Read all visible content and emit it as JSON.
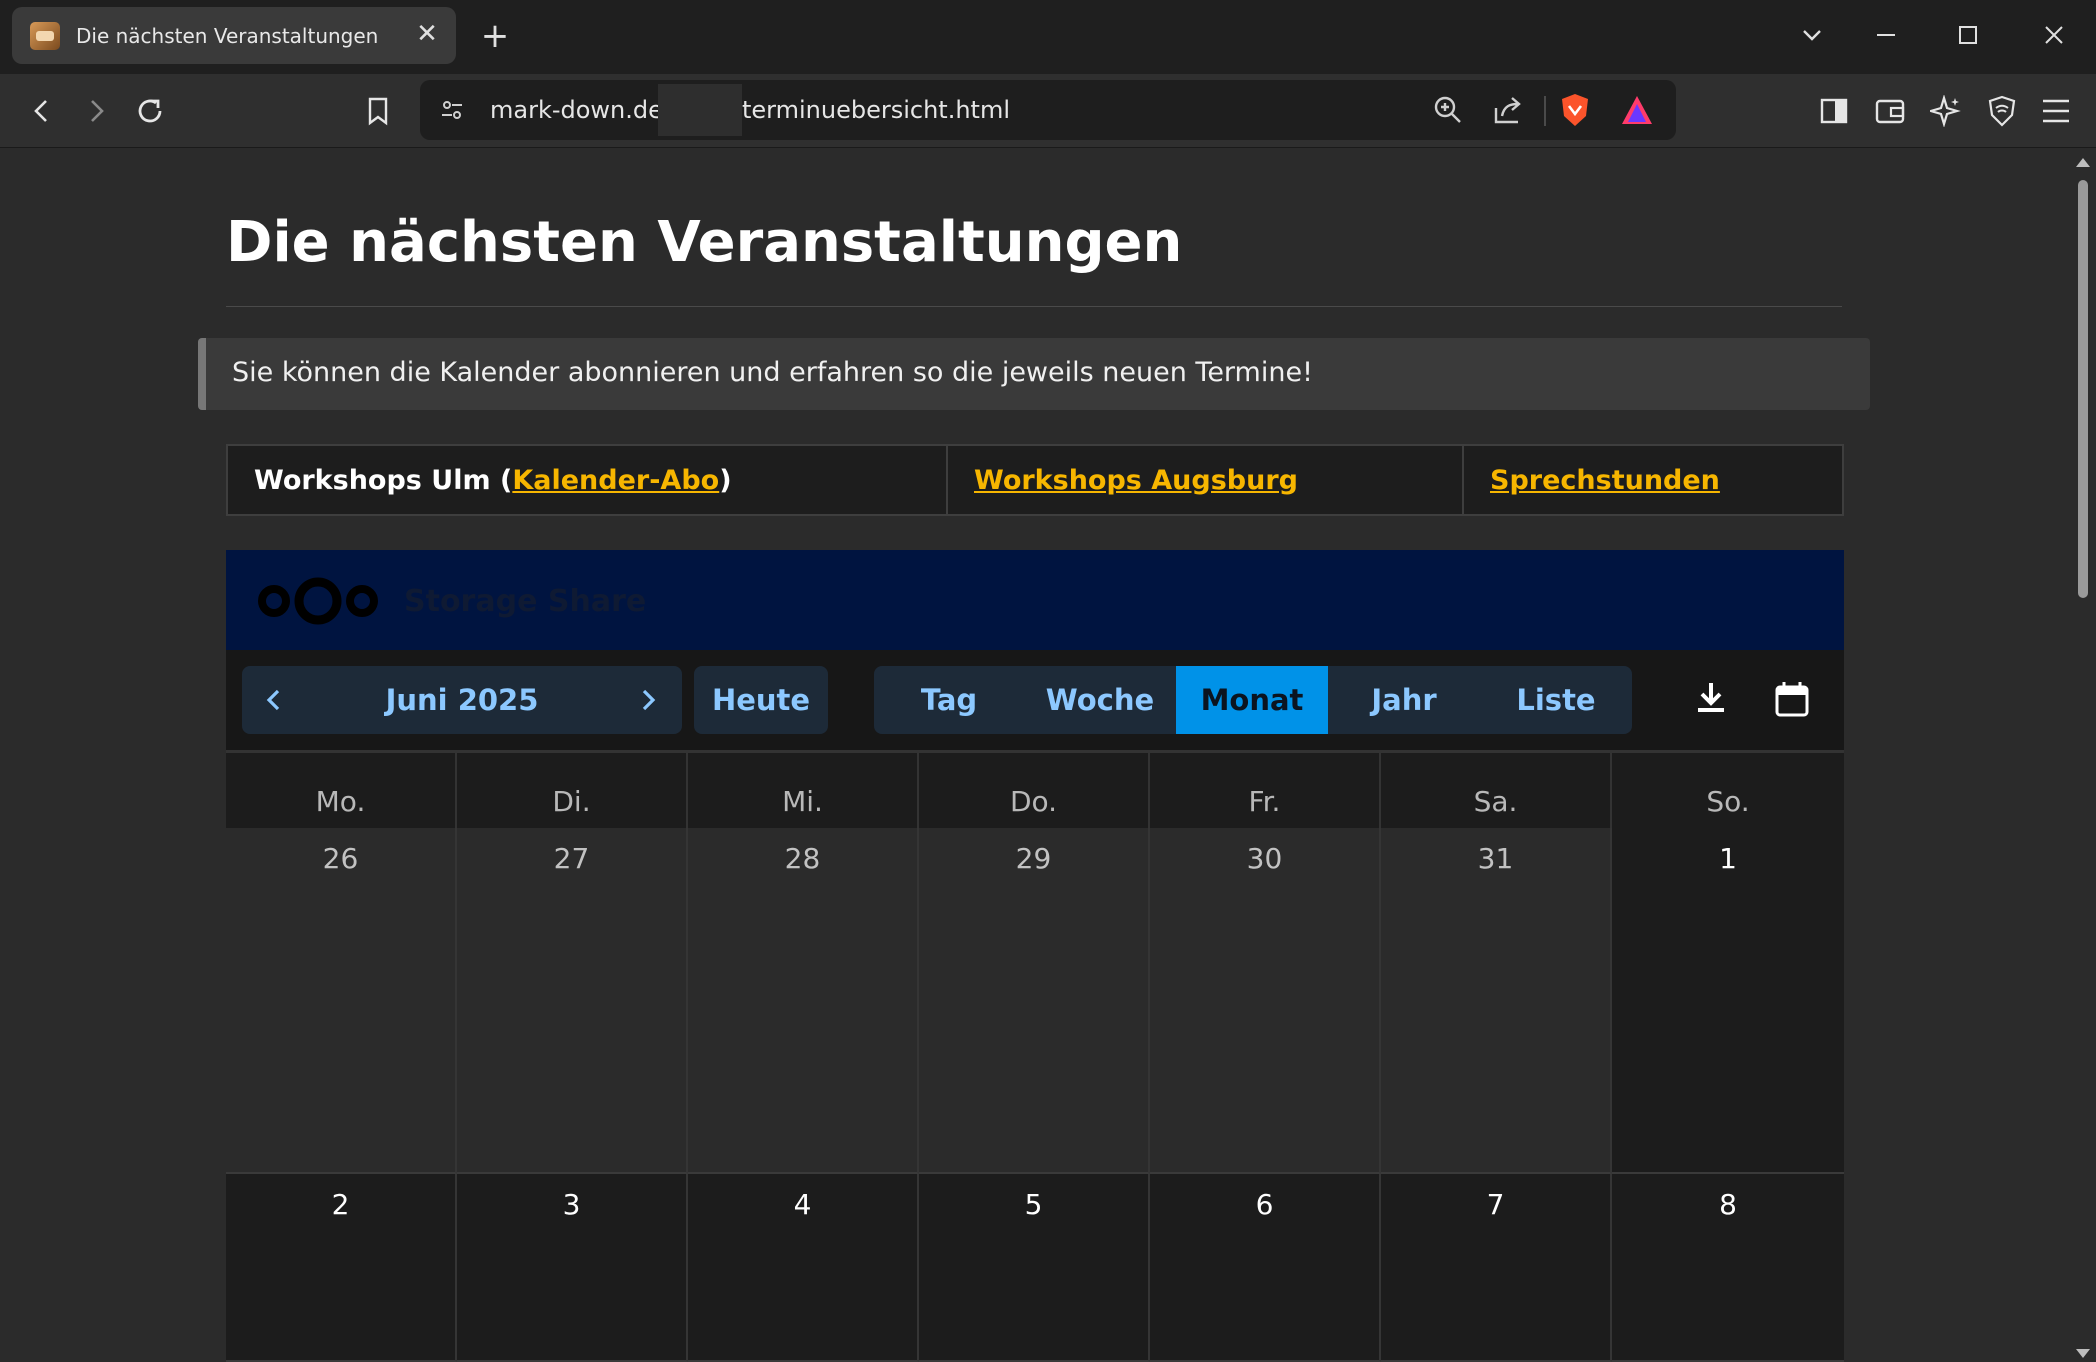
{
  "browser": {
    "tab_title": "Die nächsten Veranstaltungen",
    "url_host": "mark-down.de",
    "url_path": "terminuebersicht.html"
  },
  "page": {
    "title": "Die nächsten Veranstaltungen",
    "notice": "Sie können die Kalender abonnieren und erfahren so die jeweils neuen Termine!",
    "links": {
      "ulm_prefix": "Workshops Ulm (",
      "ulm_link": "Kalender-Abo",
      "ulm_suffix": ")",
      "augsburg": "Workshops Augsburg",
      "sprechstunden": "Sprechstunden"
    }
  },
  "calendar": {
    "brand": "Storage Share",
    "month_label": "Juni 2025",
    "today": "Heute",
    "views": [
      "Tag",
      "Woche",
      "Monat",
      "Jahr",
      "Liste"
    ],
    "active_view": "Monat",
    "weekdays": [
      "Mo.",
      "Di.",
      "Mi.",
      "Do.",
      "Fr.",
      "Sa.",
      "So."
    ],
    "week1": [
      "26",
      "27",
      "28",
      "29",
      "30",
      "31",
      "1"
    ],
    "week2": [
      "2",
      "3",
      "4",
      "5",
      "6",
      "7",
      "8"
    ]
  },
  "colors": {
    "link": "#f7b600",
    "accent": "#0092e8",
    "nav_text": "#8cc8ff",
    "header_bg": "#001440"
  }
}
